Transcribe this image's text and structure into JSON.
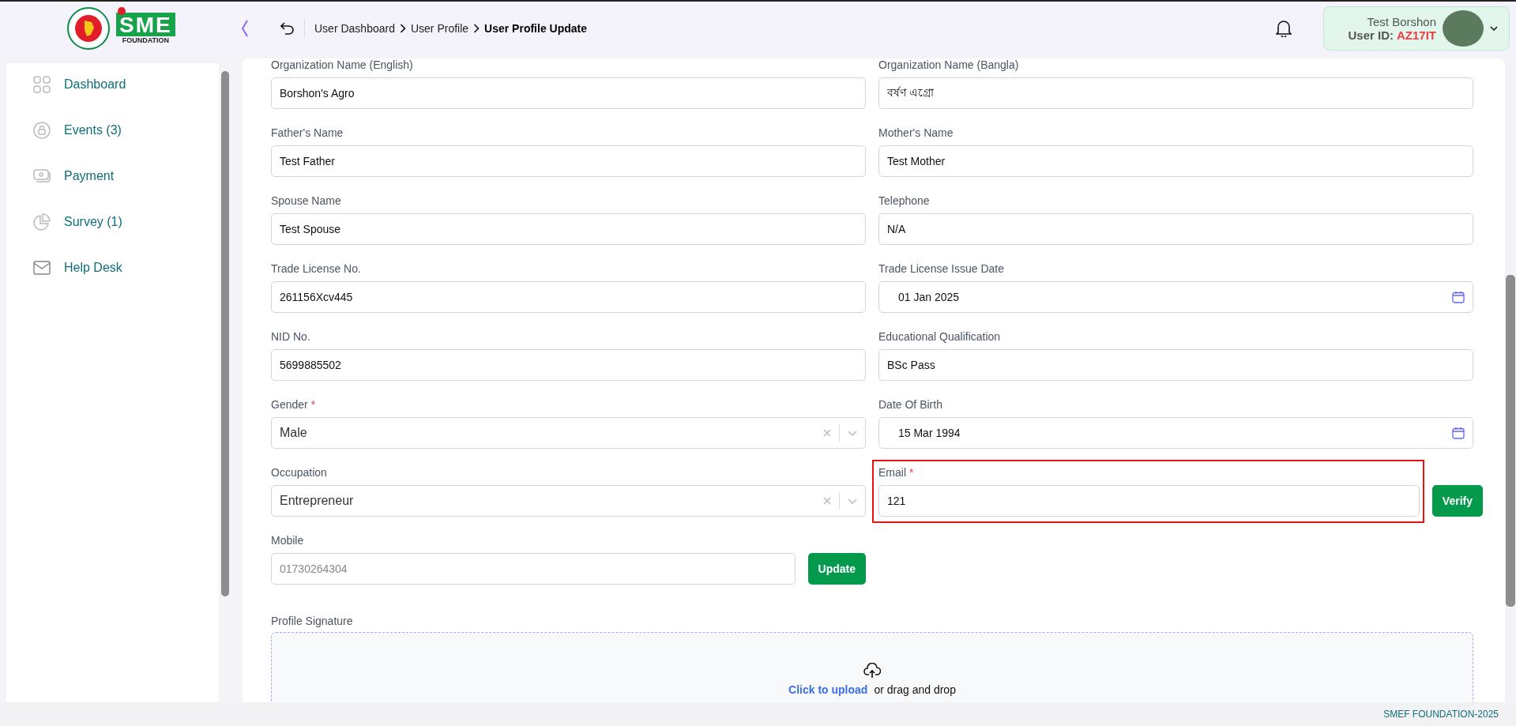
{
  "header": {
    "logo": {
      "letters": "SME",
      "subtitle": "FOUNDATION"
    },
    "breadcrumbs": [
      {
        "label": "User Dashboard",
        "current": false
      },
      {
        "label": "User Profile",
        "current": false
      },
      {
        "label": "User Profile Update",
        "current": true
      }
    ],
    "user": {
      "name": "Test Borshon",
      "id_label": "User ID:",
      "id": "AZ17IT"
    }
  },
  "sidebar": {
    "items": [
      {
        "label": "Dashboard"
      },
      {
        "label": "Events (3)"
      },
      {
        "label": "Payment"
      },
      {
        "label": "Survey (1)"
      },
      {
        "label": "Help Desk"
      }
    ]
  },
  "form": {
    "fields": [
      {
        "kind": "text",
        "label": "Organization Name (English)",
        "required": false,
        "value": "Borshon's Agro",
        "disabled": false,
        "highlighted": false
      },
      {
        "kind": "text",
        "label": "Organization Name (Bangla)",
        "required": false,
        "value": "বর্ষণ এগ্রো",
        "disabled": false,
        "highlighted": false
      },
      {
        "kind": "text",
        "label": "Father's Name",
        "required": false,
        "value": "Test Father",
        "disabled": false,
        "highlighted": false
      },
      {
        "kind": "text",
        "label": "Mother's Name",
        "required": false,
        "value": "Test Mother",
        "disabled": false,
        "highlighted": false
      },
      {
        "kind": "text",
        "label": "Spouse Name",
        "required": false,
        "value": "Test Spouse",
        "disabled": false,
        "highlighted": false
      },
      {
        "kind": "text",
        "label": "Telephone",
        "required": false,
        "value": "N/A",
        "disabled": false,
        "highlighted": false
      },
      {
        "kind": "text",
        "label": "Trade License No.",
        "required": false,
        "value": "261156Xcv445",
        "disabled": false,
        "highlighted": false
      },
      {
        "kind": "date",
        "label": "Trade License Issue Date",
        "required": false,
        "value": "01 Jan 2025",
        "disabled": false,
        "highlighted": false
      },
      {
        "kind": "text",
        "label": "NID No.",
        "required": false,
        "value": "5699885502",
        "disabled": false,
        "highlighted": false
      },
      {
        "kind": "text",
        "label": "Educational Qualification",
        "required": false,
        "value": "BSc Pass",
        "disabled": false,
        "highlighted": false
      },
      {
        "kind": "select",
        "label": "Gender",
        "required": true,
        "value": "Male",
        "disabled": false,
        "highlighted": false
      },
      {
        "kind": "date",
        "label": "Date Of Birth",
        "required": false,
        "value": "15 Mar 1994",
        "disabled": false,
        "highlighted": false
      },
      {
        "kind": "select",
        "label": "Occupation",
        "required": false,
        "value": "Entrepreneur",
        "disabled": false,
        "highlighted": false
      },
      {
        "kind": "action",
        "label": "Email",
        "required": true,
        "value": "121",
        "button": "Verify",
        "disabled": false,
        "highlighted": true
      },
      {
        "kind": "action",
        "label": "Mobile",
        "required": false,
        "value": "01730264304",
        "button": "Update",
        "disabled": true,
        "highlighted": false
      }
    ],
    "required_mark": "*",
    "signature": {
      "label": "Profile Signature",
      "link": "Click to upload",
      "text": "or drag and drop"
    }
  },
  "footer": {
    "text": "SMEF FOUNDATION-2025"
  }
}
